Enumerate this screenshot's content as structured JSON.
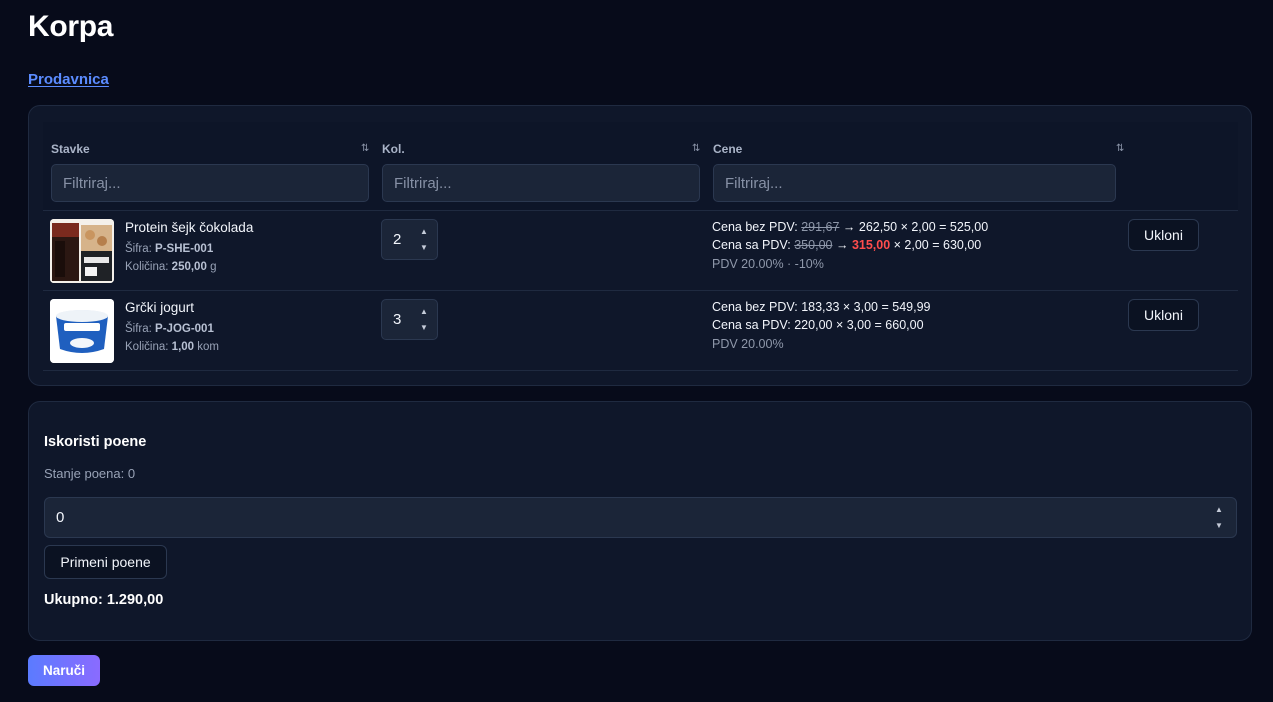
{
  "page": {
    "title": "Korpa",
    "store_link": "Prodavnica"
  },
  "table": {
    "columns": [
      {
        "label": "Stavke",
        "sort_icon": "sort-icon",
        "filter_placeholder": "Filtriraj..."
      },
      {
        "label": "Kol.",
        "sort_icon": "sort-icon",
        "filter_placeholder": "Filtriraj..."
      },
      {
        "label": "Cene",
        "sort_icon": "sort-icon",
        "filter_placeholder": "Filtriraj..."
      }
    ],
    "rows": [
      {
        "name": "Protein šejk čokolada",
        "sku_label": "Šifra:",
        "sku": "P-SHE-001",
        "amount_label": "Količina:",
        "amount": "250,00",
        "unit": "g",
        "quantity": "2",
        "net_label": "Cena bez PDV:",
        "net_old": "291,67",
        "net_rest": "→ 262,50 × 2,00 = 525,00",
        "gross_label": "Cena sa PDV:",
        "gross_old": "350,00",
        "gross_arrow": "→",
        "gross_sale": "315,00",
        "gross_rest": "× 2,00 = 630,00",
        "vat": "PDV 20.00% · -10%",
        "remove_label": "Ukloni"
      },
      {
        "name": "Grčki jogurt",
        "sku_label": "Šifra:",
        "sku": "P-JOG-001",
        "amount_label": "Količina:",
        "amount": "1,00",
        "unit": "kom",
        "quantity": "3",
        "net_label": "Cena bez PDV:",
        "net_rest": "183,33 × 3,00 = 549,99",
        "gross_label": "Cena sa PDV:",
        "gross_rest": "220,00 × 3,00 = 660,00",
        "vat": "PDV 20.00%",
        "remove_label": "Ukloni"
      }
    ]
  },
  "points": {
    "title": "Iskoristi poene",
    "balance": "Stanje poena: 0",
    "input_value": "0",
    "apply_label": "Primeni poene",
    "total": "Ukupno: 1.290,00"
  },
  "order_label": "Naruči",
  "colors": {
    "background": "#070b1a",
    "card": "#0f172a",
    "link": "#5b8cff",
    "sale": "#ff4d4d",
    "order_gradient_start": "#5b7bff",
    "order_gradient_end": "#8a6bff"
  }
}
